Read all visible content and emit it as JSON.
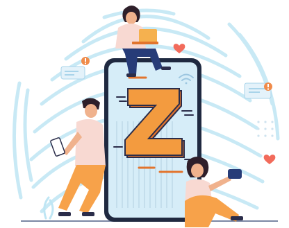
{
  "illustration": {
    "letter": "Z"
  },
  "colors": {
    "background": "#ffffff",
    "fingerprint": "#bfe6f4",
    "phone_body": "#1f2940",
    "phone_screen": "#d6edf8",
    "z_fill": "#f39b3f",
    "z_shadow": "#e2742d",
    "z_outline": "#2b2d4a",
    "person_shirt": "#f8d9d2",
    "person_pants_navy": "#273c78",
    "person_pants_orange": "#f7a24a",
    "skin": "#f0b28d",
    "hair_dark": "#2e1f2a",
    "laptop": "#f5b14f",
    "heart": "#f26b5b",
    "notification": "#f08b4a",
    "ground": "#7a86a3"
  },
  "icons": {
    "heart": "heart-icon",
    "notification": "notification-bubble-icon",
    "wifi": "wifi-icon",
    "chat": "chat-bubble-icon"
  }
}
